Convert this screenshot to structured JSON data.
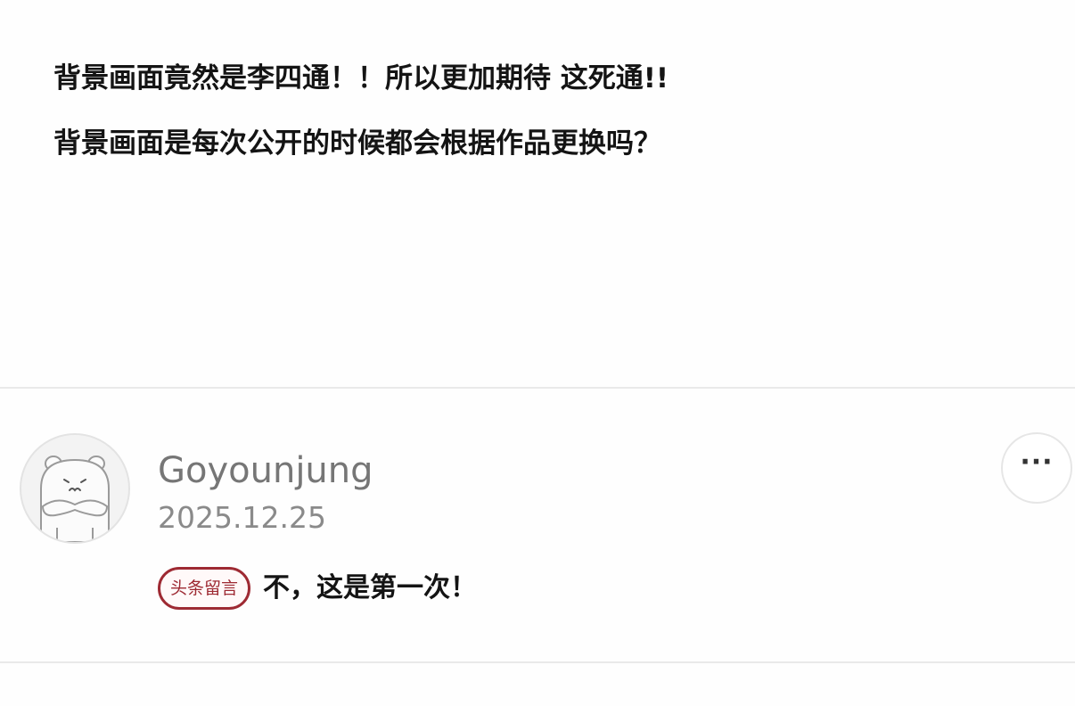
{
  "post": {
    "line1": "背景画面竟然是李四通！！所以更加期待 这死通!!",
    "line2": "背景画面是每次公开的时候都会根据作品更换吗？"
  },
  "comment": {
    "avatar_icon": "hamster-avatar-icon",
    "username": "Goyounjung",
    "date": "2025.12.25",
    "badge_label": "头条留言",
    "text": "不，这是第一次！",
    "more_icon": "more-dots-icon",
    "more_symbol": "···"
  },
  "colors": {
    "badge": "#9e2a33",
    "text_primary": "#141414",
    "text_secondary": "#767676",
    "divider": "#e9e9e9"
  }
}
